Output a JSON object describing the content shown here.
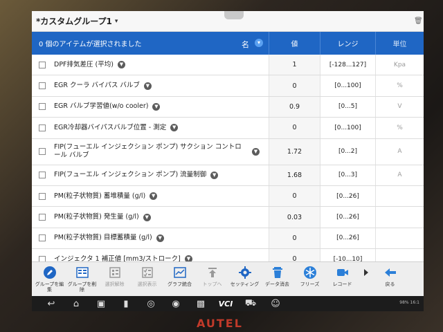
{
  "header": {
    "title": "*カスタムグループ1",
    "dropdown_glyph": "▾"
  },
  "table": {
    "selected_text": "0 個のアイテムが選択されました",
    "col_name": "名",
    "col_value": "値",
    "col_range": "レンジ",
    "col_unit": "単位",
    "rows": [
      {
        "name": "DPF排気差圧 (平均)",
        "value": "1",
        "range": "[-128...127]",
        "unit": "Kpa"
      },
      {
        "name": "EGR クーラ バイパス バルブ",
        "value": "0",
        "range": "[0...100]",
        "unit": "%"
      },
      {
        "name": "EGR バルブ学習値(w/o cooler)",
        "value": "0.9",
        "range": "[0...5]",
        "unit": "V"
      },
      {
        "name": "EGR冷却器バイパスバルブ位置 - 測定",
        "value": "0",
        "range": "[0...100]",
        "unit": "%"
      },
      {
        "name": "FIP(フューエル インジェクション ポンプ) サクション コントロール バルブ",
        "value": "1.72",
        "range": "[0...2]",
        "unit": "A"
      },
      {
        "name": "FIP(フューエル インジェクション ポンプ) 流量制御",
        "value": "1.68",
        "range": "[0...3]",
        "unit": "A"
      },
      {
        "name": "PM(粒子状物質) 蓄堆積量 (g/l)",
        "value": "0",
        "range": "[0...26]",
        "unit": ""
      },
      {
        "name": "PM(粒子状物質) 発生量 (g/l)",
        "value": "0.03",
        "range": "[0...26]",
        "unit": ""
      },
      {
        "name": "PM(粒子状物質) 目標蓄積量 (g/l)",
        "value": "0",
        "range": "[0...26]",
        "unit": ""
      },
      {
        "name": "インジェクタ 1 補正値 [mm3/ストローク]",
        "value": "0",
        "range": "[-10...10]",
        "unit": ""
      }
    ]
  },
  "toolbar": {
    "items": [
      {
        "label": "グループを編集",
        "icon": "pencil-icon"
      },
      {
        "label": "グループを削除",
        "icon": "delete-group-icon"
      },
      {
        "label": "選択解除",
        "icon": "deselect-icon"
      },
      {
        "label": "選択表示",
        "icon": "show-selected-icon"
      },
      {
        "label": "グラフ統合",
        "icon": "graph-merge-icon"
      },
      {
        "label": "トップへ",
        "icon": "to-top-icon"
      },
      {
        "label": "セッティング",
        "icon": "settings-gear-icon"
      },
      {
        "label": "データ消去",
        "icon": "trash-icon"
      },
      {
        "label": "フリーズ",
        "icon": "snowflake-icon"
      },
      {
        "label": "レコード",
        "icon": "video-camera-icon"
      },
      {
        "label": "戻る",
        "icon": "back-arrow-icon"
      }
    ]
  },
  "navbar": {
    "vci_label": "VCI",
    "status_text": "98% 16:1"
  },
  "brand": "AUTEL",
  "colors": {
    "header_blue": "#1f66c4",
    "toolbar_icon_blue": "#1f66c4",
    "trash_blue": "#2b7fd8",
    "brand_red": "#c23a2a"
  }
}
